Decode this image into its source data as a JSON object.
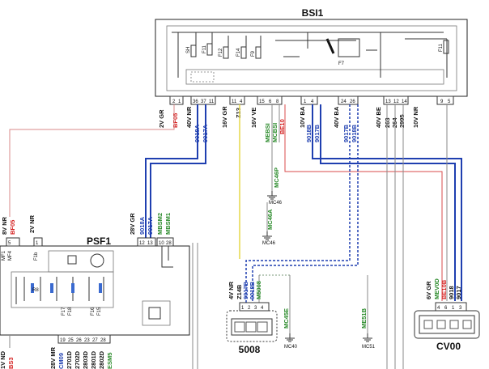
{
  "modules": {
    "bsi": {
      "title": "BSI1"
    },
    "psf": {
      "title": "PSF1"
    },
    "m5008": {
      "title": "5008"
    },
    "cv00": {
      "title": "CV00"
    }
  },
  "bsi_connectors": [
    {
      "id": "c1",
      "label": "2V GR",
      "pins": [
        "2",
        "1"
      ]
    },
    {
      "id": "c2",
      "label": "40V NR",
      "pins": [
        "36",
        "37",
        "11"
      ]
    },
    {
      "id": "c3",
      "label": "16V GR",
      "pins": [
        "11",
        "4"
      ]
    },
    {
      "id": "c4",
      "label": "16V VE",
      "pins": [
        "15",
        "6",
        "8"
      ]
    },
    {
      "id": "c5",
      "label": "10V BA",
      "pins": [
        "1",
        "4"
      ]
    },
    {
      "id": "c6",
      "label": "40V BA",
      "pins": [
        "24",
        "26"
      ]
    },
    {
      "id": "c7",
      "label": "40V BE",
      "pins": [
        "13",
        "12",
        "14"
      ]
    },
    {
      "id": "c8",
      "label": "10V NR",
      "pins": [
        "9",
        "5"
      ]
    }
  ],
  "bsi_wires": [
    "BF05",
    "9018A",
    "9017A",
    "Z13",
    "MEBSI",
    "MCBSI",
    "BE10",
    "9018B",
    "9017B",
    "9017B",
    "9018B",
    "263",
    "264",
    "2995"
  ],
  "bsi_internal_labels": [
    "F11",
    "F12",
    "F14",
    "F9",
    "F7",
    "SH",
    "F11"
  ],
  "psf_connectors": [
    {
      "label": "8V NR",
      "pins": [
        "5"
      ]
    },
    {
      "label": "2V NR",
      "pins": [
        "1"
      ]
    },
    {
      "label": "28V GR",
      "pins": [
        "12",
        "13"
      ]
    },
    {
      "label": "28V MR",
      "pins": [
        "19",
        "25",
        "26",
        "23",
        "27",
        "28"
      ]
    },
    {
      "label": "1V ND",
      "pins": []
    }
  ],
  "psf_wires": [
    "BF05",
    "9018A",
    "9017A",
    "MBSM2",
    "MBSM1",
    "CM09",
    "2701D",
    "2702D",
    "2803D",
    "2801D",
    "2802D",
    "ESM5",
    "BS3"
  ],
  "psf_internal_labels": [
    "MF1",
    "MF4",
    "F1b",
    "F18",
    "F17",
    "F18",
    "F16",
    "F15",
    "R8"
  ],
  "psf_pins_top": [
    "10",
    "28"
  ],
  "m5008_connector": {
    "label": "4V NR",
    "wires": [
      "Z14B",
      "9017B",
      "9018B",
      "M5008"
    ],
    "pins": [
      "1",
      "2",
      "3",
      "4"
    ]
  },
  "cv00_connector": {
    "label": "6V GR",
    "wires": [
      "MEV0D",
      "BE10B",
      "9018",
      "9017"
    ],
    "pins": [
      "4",
      "6",
      "1",
      "3"
    ]
  },
  "grounds": [
    "MC46",
    "MC46",
    "MC40",
    "MC45",
    "MC51"
  ],
  "ground_wires": [
    "MC46P",
    "MC46A",
    "MC45E",
    "ME51B"
  ],
  "colors": {
    "blue_wire": "#1f3fb0",
    "yellow_wire": "#e6d84a",
    "red_wire": "#d94b4b",
    "green_text": "#2a8a2a",
    "red_text": "#d42020",
    "blue_text": "#1f3fb0"
  }
}
